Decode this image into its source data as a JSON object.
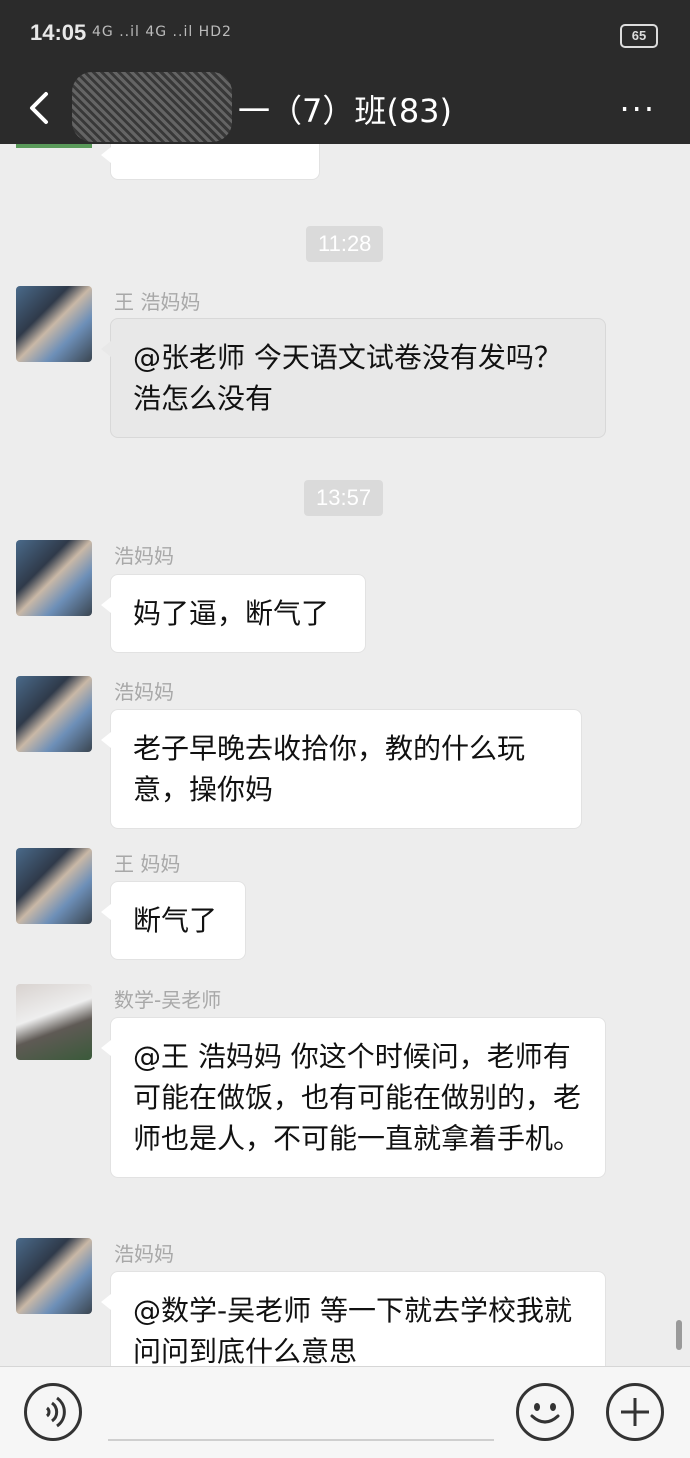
{
  "status_bar": {
    "time": "14:05",
    "signal": "4G ..il 4G ..il HD2",
    "battery": "65"
  },
  "header": {
    "title": "一（7）班(83)",
    "more": "···"
  },
  "timestamps": [
    "11:28",
    "13:57"
  ],
  "messages": [
    {
      "sender": "王 浩妈妈",
      "text": "@张老师  今天语文试卷没有发吗？ 浩怎么没有"
    },
    {
      "sender": "浩妈妈",
      "text": "妈了逼，断气了"
    },
    {
      "sender": "浩妈妈",
      "text": "老子早晚去收拾你，教的什么玩意，操你妈"
    },
    {
      "sender": "王 妈妈",
      "text": "断气了"
    },
    {
      "sender": "数学-吴老师",
      "text": "@王 浩妈妈  你这个时候问，老师有可能在做饭，也有可能在做别的，老师也是人，不可能一直就拿着手机。"
    },
    {
      "sender": "浩妈妈",
      "text": "@数学-吴老师  等一下就去学校我就问问到底什么意思"
    }
  ],
  "icons": {
    "back": "chevron-left-icon",
    "voice": "voice-icon",
    "emoji": "emoji-icon",
    "add": "plus-icon"
  }
}
